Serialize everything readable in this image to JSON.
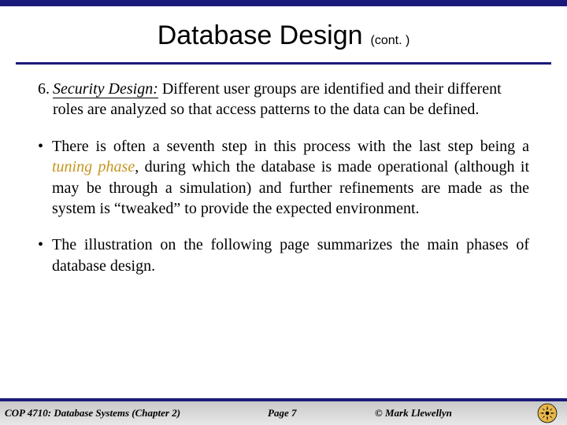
{
  "title": {
    "main": "Database Design",
    "cont": "(cont. )"
  },
  "content": {
    "item6_number": "6.",
    "item6_label": "Security Design:",
    "item6_text": "  Different user groups are identified and their different roles are analyzed so that access patterns to the data can be defined.",
    "bullet1_pre": "There is often a seventh step in this process with the last step being a ",
    "bullet1_em": "tuning phase",
    "bullet1_post": ", during which the database is made operational (although it may be through a simulation) and further refinements are made as the system is “tweaked” to provide the expected environment.",
    "bullet2": "The illustration on the following page summarizes the main phases of database design."
  },
  "footer": {
    "course": "COP 4710: Database Systems  (Chapter 2)",
    "page": "Page 7",
    "copyright": "© Mark Llewellyn"
  }
}
